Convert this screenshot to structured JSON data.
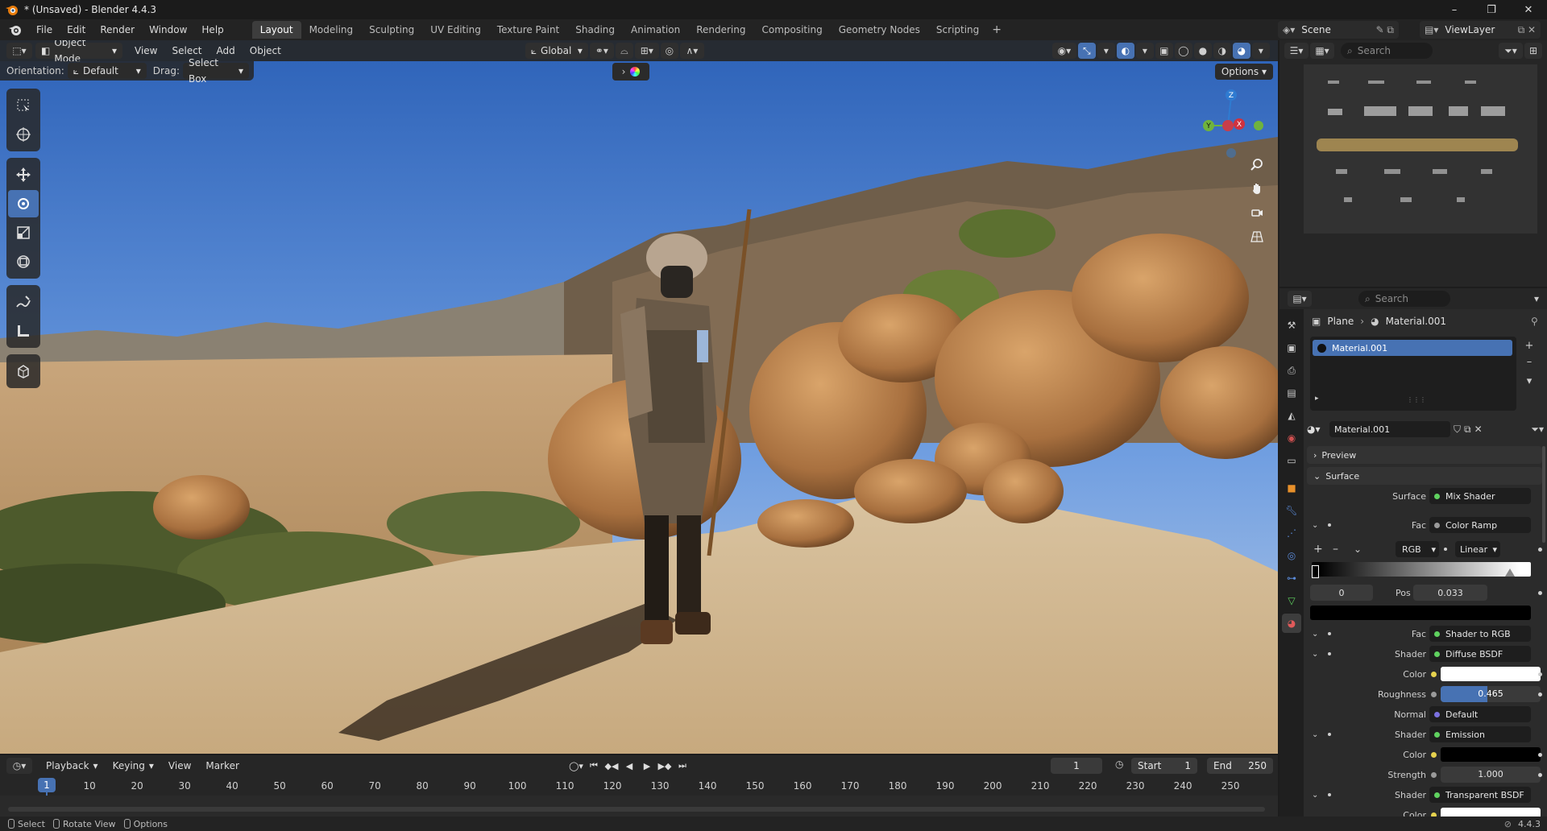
{
  "window": {
    "title": "* (Unsaved) - Blender 4.4.3",
    "controls": {
      "minimize": "–",
      "maximize": "❐",
      "close": "✕"
    }
  },
  "menus": [
    "File",
    "Edit",
    "Render",
    "Window",
    "Help"
  ],
  "workspaces": [
    "Layout",
    "Modeling",
    "Sculpting",
    "UV Editing",
    "Texture Paint",
    "Shading",
    "Animation",
    "Rendering",
    "Compositing",
    "Geometry Nodes",
    "Scripting"
  ],
  "workspace_add": "+",
  "active_workspace": "Layout",
  "scene": {
    "name": "Scene",
    "view_layer": "ViewLayer"
  },
  "viewport": {
    "mode": "Object Mode",
    "menus": [
      "View",
      "Select",
      "Add",
      "Object"
    ],
    "transform_orientation": "Global",
    "orientation_label": "Orientation:",
    "orientation_value": "Default",
    "drag_label": "Drag:",
    "drag_value": "Select Box",
    "options_label": "Options",
    "gizmo_axes": {
      "z": "Z",
      "y": "Y",
      "x": "X"
    }
  },
  "timeline": {
    "menus": [
      "Playback",
      "Keying",
      "View",
      "Marker"
    ],
    "current_frame": "1",
    "start_label": "Start",
    "start": "1",
    "end_label": "End",
    "end": "250",
    "ticks": [
      "10",
      "20",
      "30",
      "40",
      "50",
      "60",
      "70",
      "80",
      "90",
      "100",
      "110",
      "120",
      "130",
      "140",
      "150",
      "160",
      "170",
      "180",
      "190",
      "200",
      "210",
      "220",
      "230",
      "240",
      "250"
    ],
    "cursor_frame": "1"
  },
  "status_bar": {
    "items": [
      "Select",
      "Rotate View",
      "Options"
    ],
    "version": "4.4.3"
  },
  "outliner": {
    "search_placeholder": "Search"
  },
  "properties": {
    "search_placeholder": "Search",
    "breadcrumb_object": "Plane",
    "breadcrumb_material": "Material.001",
    "material_slot": "Material.001",
    "material_name": "Material.001",
    "panels": {
      "preview": "Preview",
      "surface": "Surface"
    },
    "rows": {
      "surface": {
        "label": "Surface",
        "value": "Mix Shader"
      },
      "fac1": {
        "label": "Fac",
        "value": "Color Ramp"
      },
      "ramp_mode": "RGB",
      "ramp_interp": "Linear",
      "ramp_stop_index": "0",
      "ramp_pos_label": "Pos",
      "ramp_pos_value": "0.033",
      "fac2": {
        "label": "Fac",
        "value": "Shader to RGB"
      },
      "shader1": {
        "label": "Shader",
        "value": "Diffuse BSDF"
      },
      "color1": {
        "label": "Color"
      },
      "roughness": {
        "label": "Roughness",
        "value": "0.465",
        "fraction": 0.465
      },
      "normal": {
        "label": "Normal",
        "value": "Default"
      },
      "shader2": {
        "label": "Shader",
        "value": "Emission"
      },
      "color2": {
        "label": "Color"
      },
      "strength": {
        "label": "Strength",
        "value": "1.000"
      },
      "shader3": {
        "label": "Shader",
        "value": "Transparent BSDF"
      },
      "color3": {
        "label": "Color"
      }
    }
  },
  "colors": {
    "accent": "#4772b3",
    "socket_shader": "#5fd15f",
    "socket_color": "#e6d24e",
    "socket_vector": "#7b70e0"
  }
}
